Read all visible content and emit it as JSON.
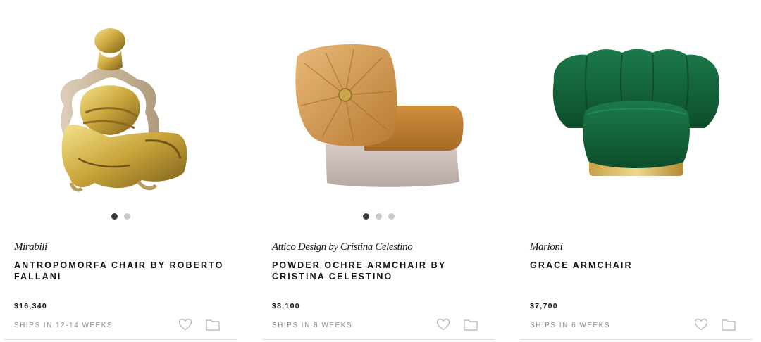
{
  "products": [
    {
      "brand": "Mirabili",
      "title": "ANTROPOMORFA CHAIR BY ROBERTO FALLANI",
      "price": "$16,340",
      "shipping": "SHIPS IN 12-14 WEEKS",
      "carousel": {
        "total_images": 2,
        "current_image": 1
      }
    },
    {
      "brand": "Attico Design by Cristina Celestino",
      "title": "POWDER OCHRE ARMCHAIR BY CRISTINA CELESTINO",
      "price": "$8,100",
      "shipping": "SHIPS IN 8 WEEKS",
      "carousel": {
        "total_images": 3,
        "current_image": 1
      }
    },
    {
      "brand": "Marioni",
      "title": "GRACE ARMCHAIR",
      "price": "$7,700",
      "shipping": "SHIPS IN 6 WEEKS",
      "carousel": null
    }
  ],
  "icons": {
    "favorite": "heart-icon",
    "save": "folder-icon"
  },
  "colors": {
    "active_dot": "#3a3a3a",
    "inactive_dot": "#c9c9c9",
    "muted_text": "#8a8a8a",
    "divider": "#dedede"
  }
}
